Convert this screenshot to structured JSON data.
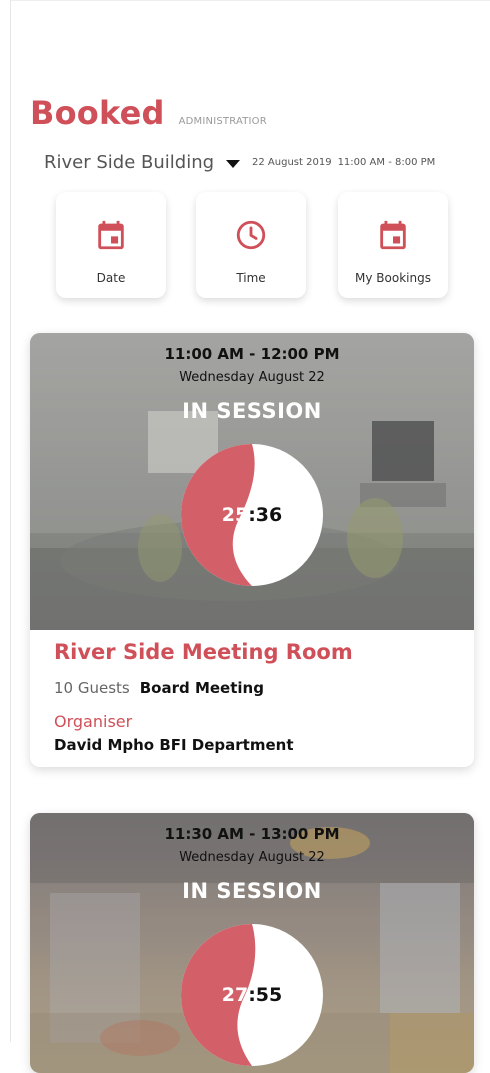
{
  "header": {
    "title": "Booked",
    "role": "ADMINISTRATIOR"
  },
  "location": {
    "building": "River Side Building",
    "date": "22 August 2019",
    "hours": "11:00 AM - 8:00 PM"
  },
  "quick_actions": [
    {
      "label": "Date",
      "icon": "calendar-icon"
    },
    {
      "label": "Time",
      "icon": "clock-icon"
    },
    {
      "label": "My Bookings",
      "icon": "calendar-icon"
    }
  ],
  "bookings": [
    {
      "time_range": "11:00 AM - 12:00 PM",
      "day": "Wednesday August 22",
      "status": "IN SESSION",
      "timer_minutes": "25",
      "timer_seconds": ":36",
      "room": "River Side Meeting Room",
      "guests": "10 Guests",
      "meeting_type": "Board Meeting",
      "organiser_label": "Organiser",
      "organiser": "David Mpho BFI Department"
    },
    {
      "time_range": "11:30 AM - 13:00 PM",
      "day": "Wednesday August 22",
      "status": "IN SESSION",
      "timer_minutes": "27",
      "timer_seconds": ":55"
    }
  ],
  "colors": {
    "accent": "#d05059",
    "text": "#111111",
    "muted": "#666666"
  }
}
